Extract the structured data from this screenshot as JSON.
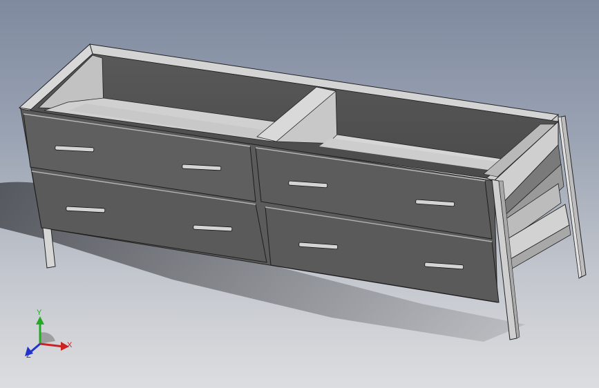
{
  "viewport": {
    "background_top": "#7f8a9f",
    "background_bottom": "#dcdde0"
  },
  "model": {
    "type": "dresser",
    "drawer_count": 4,
    "open_compartments": 2,
    "side_shelves": 2,
    "colors": {
      "body_front": "#5d5d5d",
      "body_dark": "#4a4a4a",
      "frame": "#c9c9c9",
      "shelf": "#bdbdbd",
      "handle": "#d0d0d0"
    }
  },
  "triad": {
    "x_label": "X",
    "y_label": "Y",
    "z_label": "Z",
    "x_color": "#cc2222",
    "y_color": "#22aa22",
    "z_color": "#2233cc"
  }
}
